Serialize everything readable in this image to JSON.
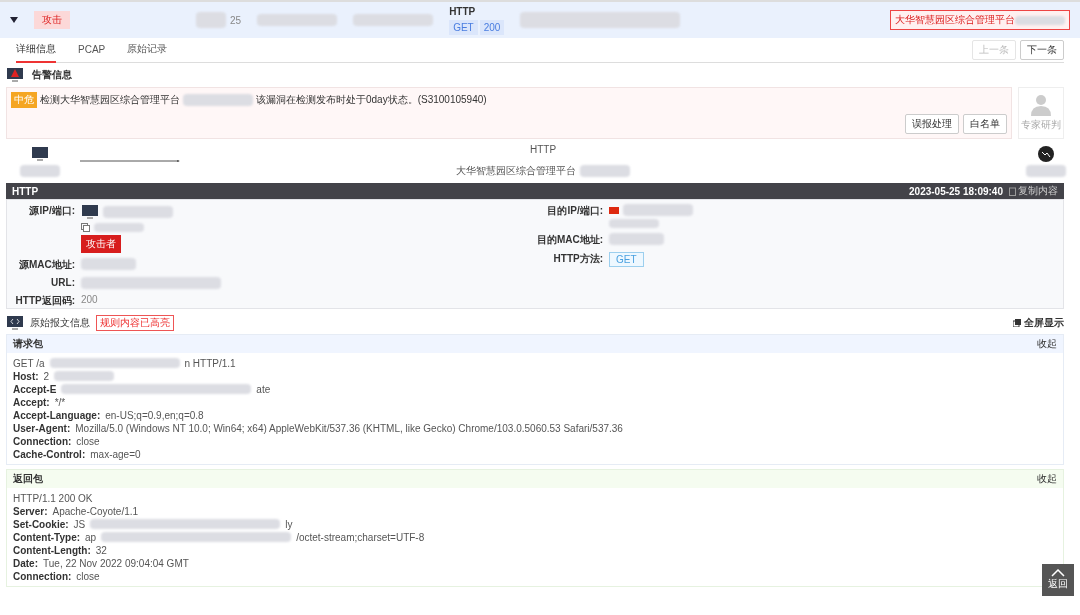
{
  "event_row": {
    "expanded": true,
    "tag": "攻击",
    "fragment": "25",
    "protocol": "HTTP",
    "method": "GET",
    "status": "200",
    "target": "大华智慧园区综合管理平台"
  },
  "tabs": [
    {
      "label": "详细信息",
      "selected": true
    },
    {
      "label": "PCAP",
      "selected": false
    },
    {
      "label": "原始记录",
      "selected": false
    }
  ],
  "pager": [
    {
      "label": "上一条",
      "disabled": true
    },
    {
      "label": "下一条",
      "disabled": false
    }
  ],
  "alert": {
    "title": "告警信息",
    "level": "中危",
    "text_before": "检测大华智慧园区综合管理平台",
    "text_after": "该漏洞在检测发布时处于0day状态。(S3100105940)",
    "buttons": [
      "误报处理",
      "白名单"
    ],
    "expert": "专家研判"
  },
  "flow": {
    "protocol": "HTTP",
    "target": "大华智慧园区综合管理平台"
  },
  "detail": {
    "title": "HTTP",
    "time": "2023-05-25 18:09:40",
    "copy": "复制内容",
    "left": [
      {
        "label": "源IP/端口:",
        "kind": "ip",
        "role": "攻击者"
      },
      {
        "label": "源MAC地址:",
        "kind": "blur"
      },
      {
        "label": "URL:",
        "kind": "blur"
      },
      {
        "label": "HTTP返回码:",
        "kind": "text",
        "value": "200"
      }
    ],
    "right": [
      {
        "label": "目的IP/端口:",
        "kind": "ip"
      },
      {
        "label": "目的MAC地址:",
        "kind": "blur"
      },
      {
        "label": "HTTP方法:",
        "kind": "tag",
        "value": "GET"
      }
    ]
  },
  "raw": {
    "title": "原始报文信息",
    "badge": "规则内容已高亮",
    "fullscreen": "全屏显示",
    "packets": [
      {
        "title": "请求包",
        "collapse": "收起",
        "kind": "request",
        "lines": [
          {
            "kind": "start",
            "text": "GET /a",
            "blurred": true,
            "after": "n HTTP/1.1"
          },
          {
            "kind": "header",
            "name": "Host:",
            "value": "2",
            "blurred": true
          },
          {
            "kind": "header",
            "name": "Accept-E",
            "blurred": true,
            "after": "ate"
          },
          {
            "kind": "header",
            "name": "Accept:",
            "value": "*/*"
          },
          {
            "kind": "header",
            "name": "Accept-Language:",
            "value": "en-US;q=0.9,en;q=0.8"
          },
          {
            "kind": "header",
            "name": "User-Agent:",
            "value": "Mozilla/5.0 (Windows NT 10.0; Win64; x64) AppleWebKit/537.36 (KHTML, like Gecko) Chrome/103.0.5060.53 Safari/537.36"
          },
          {
            "kind": "header",
            "name": "Connection:",
            "value": "close"
          },
          {
            "kind": "header",
            "name": "Cache-Control:",
            "value": "max-age=0"
          }
        ]
      },
      {
        "title": "返回包",
        "collapse": "收起",
        "kind": "response",
        "lines": [
          {
            "kind": "start",
            "text": "HTTP/1.1 200 OK"
          },
          {
            "kind": "header",
            "name": "Server:",
            "value": "Apache-Coyote/1.1"
          },
          {
            "kind": "header",
            "name": "Set-Cookie:",
            "value": "JS",
            "blurred": true,
            "after": "ly"
          },
          {
            "kind": "header",
            "name": "Content-Type:",
            "value": "ap",
            "blurred": true,
            "after": "/octet-stream;charset=UTF-8"
          },
          {
            "kind": "header",
            "name": "Content-Length:",
            "value": "32"
          },
          {
            "kind": "header",
            "name": "Date:",
            "value": "Tue, 22 Nov 2022 09:04:04 GMT"
          },
          {
            "kind": "header",
            "name": "Connection:",
            "value": "close"
          }
        ]
      }
    ]
  },
  "back_top": "返回"
}
